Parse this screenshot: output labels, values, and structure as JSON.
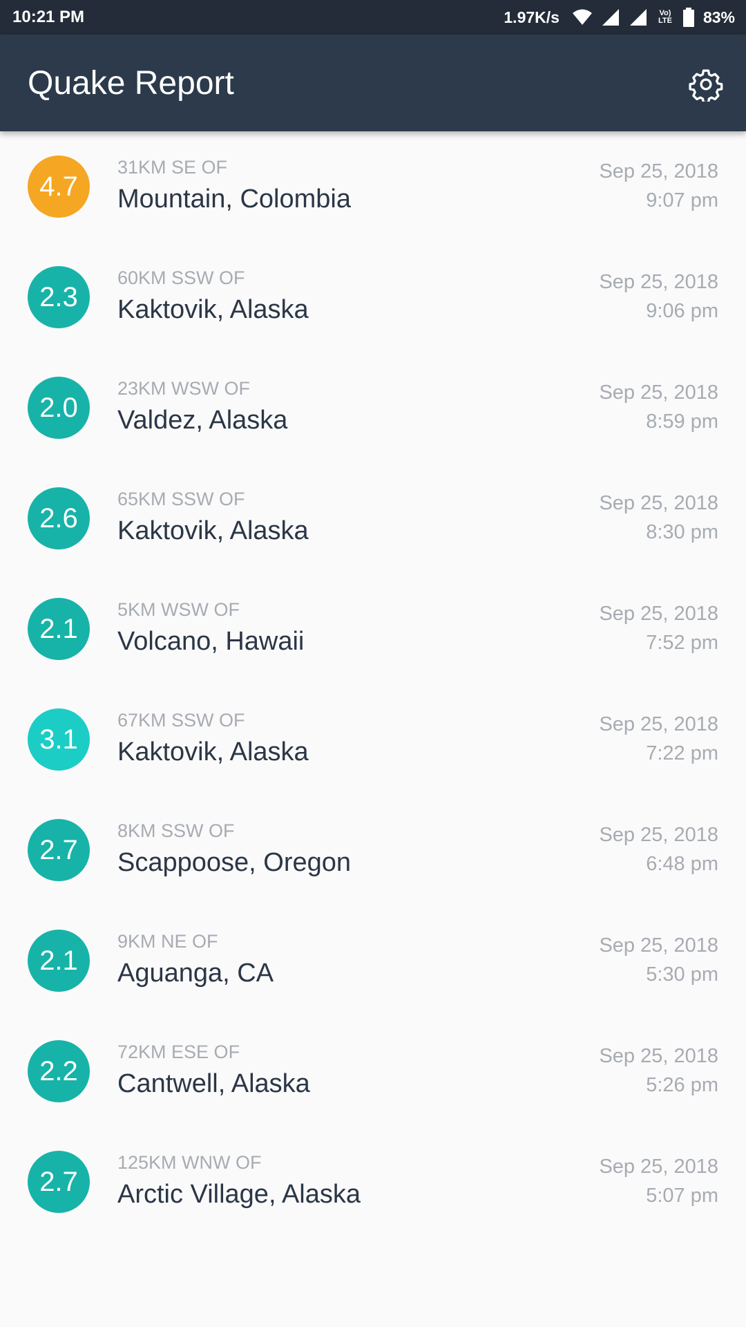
{
  "status_bar": {
    "time": "10:21 PM",
    "network_speed": "1.97K/s",
    "volte_label_top": "Vo)",
    "volte_label_bottom": "LTE",
    "battery_percent": "83%",
    "icons": [
      "wifi-icon",
      "signal-icon",
      "signal-icon",
      "volte-icon",
      "battery-icon"
    ]
  },
  "app_bar": {
    "title": "Quake Report",
    "settings_icon": "gear-icon"
  },
  "colors": {
    "status_bar_bg": "#232c38",
    "app_bar_bg": "#2c3a4b",
    "list_bg": "#fafafa",
    "mag_orange": "#f5a623",
    "mag_teal": "#17b3a8",
    "mag_cyan": "#1ccdc6",
    "primary_text": "#2b3646",
    "secondary_text": "#a7abb2"
  },
  "earthquakes": [
    {
      "magnitude": "4.7",
      "mag_color": "#f5a623",
      "offset": "31KM SE OF",
      "location": "Mountain, Colombia",
      "date": "Sep 25, 2018",
      "time": "9:07 pm"
    },
    {
      "magnitude": "2.3",
      "mag_color": "#17b3a8",
      "offset": "60KM SSW OF",
      "location": "Kaktovik, Alaska",
      "date": "Sep 25, 2018",
      "time": "9:06 pm"
    },
    {
      "magnitude": "2.0",
      "mag_color": "#17b3a8",
      "offset": "23KM WSW OF",
      "location": "Valdez, Alaska",
      "date": "Sep 25, 2018",
      "time": "8:59 pm"
    },
    {
      "magnitude": "2.6",
      "mag_color": "#17b3a8",
      "offset": "65KM SSW OF",
      "location": "Kaktovik, Alaska",
      "date": "Sep 25, 2018",
      "time": "8:30 pm"
    },
    {
      "magnitude": "2.1",
      "mag_color": "#17b3a8",
      "offset": "5KM WSW OF",
      "location": "Volcano, Hawaii",
      "date": "Sep 25, 2018",
      "time": "7:52 pm"
    },
    {
      "magnitude": "3.1",
      "mag_color": "#1ccdc6",
      "offset": "67KM SSW OF",
      "location": "Kaktovik, Alaska",
      "date": "Sep 25, 2018",
      "time": "7:22 pm"
    },
    {
      "magnitude": "2.7",
      "mag_color": "#17b3a8",
      "offset": "8KM SSW OF",
      "location": "Scappoose, Oregon",
      "date": "Sep 25, 2018",
      "time": "6:48 pm"
    },
    {
      "magnitude": "2.1",
      "mag_color": "#17b3a8",
      "offset": "9KM NE OF",
      "location": "Aguanga, CA",
      "date": "Sep 25, 2018",
      "time": "5:30 pm"
    },
    {
      "magnitude": "2.2",
      "mag_color": "#17b3a8",
      "offset": "72KM ESE OF",
      "location": "Cantwell, Alaska",
      "date": "Sep 25, 2018",
      "time": "5:26 pm"
    },
    {
      "magnitude": "2.7",
      "mag_color": "#17b3a8",
      "offset": "125KM WNW OF",
      "location": "Arctic Village, Alaska",
      "date": "Sep 25, 2018",
      "time": "5:07 pm"
    }
  ]
}
